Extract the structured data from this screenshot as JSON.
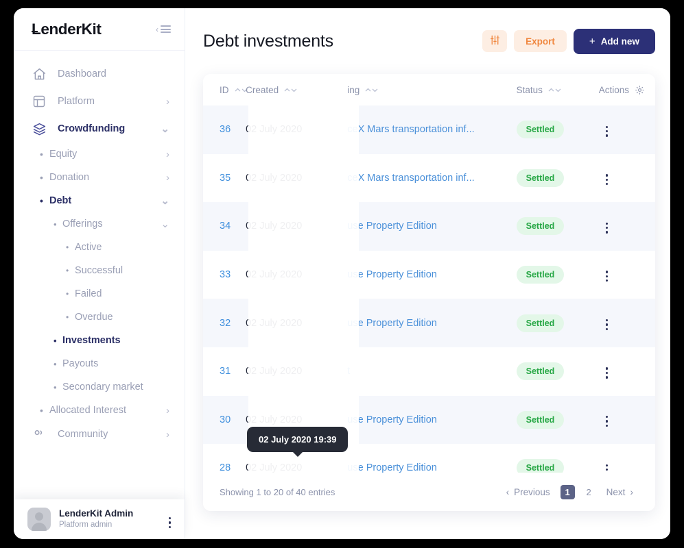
{
  "brand": {
    "name": "LenderKit",
    "collapse_icon": "collapse-menu-icon"
  },
  "sidebar": {
    "dashboard": {
      "label": "Dashboard",
      "icon": "home-icon"
    },
    "platform": {
      "label": "Platform",
      "icon": "layout-icon",
      "arrow": "›"
    },
    "crowdfunding": {
      "label": "Crowdfunding",
      "icon": "layers-icon",
      "arrow": "⌄"
    },
    "sub_items": [
      {
        "label": "Equity",
        "arrow": "›",
        "bullet": "•"
      },
      {
        "label": "Donation",
        "arrow": "›",
        "bullet": "•"
      },
      {
        "label": "Debt",
        "arrow": "⌄",
        "bullet": "•"
      }
    ],
    "offerings": {
      "label": "Offerings",
      "arrow": "⌄",
      "bullet": "•"
    },
    "offering_items": [
      {
        "label": "Active",
        "bullet": "•"
      },
      {
        "label": "Successful",
        "bullet": "•"
      },
      {
        "label": "Failed",
        "bullet": "•"
      },
      {
        "label": "Overdue",
        "bullet": "•"
      }
    ],
    "debt_items": [
      {
        "label": "Investments",
        "bullet": "•"
      },
      {
        "label": "Payouts",
        "bullet": "•"
      },
      {
        "label": "Secondary market",
        "bullet": "•"
      }
    ],
    "allocated_interest": {
      "label": "Allocated Interest",
      "arrow": "›",
      "bullet": "•"
    },
    "community": {
      "label": "Community",
      "arrow": "›",
      "icon": "community-icon"
    }
  },
  "user": {
    "name": "LenderKit Admin",
    "role": "Platform admin",
    "menu_icon": "three-dots-vertical-icon"
  },
  "header": {
    "title": "Debt investments",
    "filter_icon": "sliders-filter-icon",
    "export_label": "Export",
    "add_new_label": "Add new",
    "add_new_plus": "+"
  },
  "table": {
    "columns": [
      {
        "key": "id",
        "label": "ID",
        "sortable": true
      },
      {
        "key": "created",
        "label": "Created",
        "sortable": true
      },
      {
        "key": "offering",
        "label": "ing",
        "sortable": true
      },
      {
        "key": "status",
        "label": "Status",
        "sortable": true
      },
      {
        "key": "actions",
        "label": "Actions",
        "sortable": false,
        "gear_icon": "gear-icon"
      }
    ],
    "rows": [
      {
        "id": "36",
        "created": "02 July 2020",
        "offering": "ceX Mars transportation inf...",
        "status": "Settled"
      },
      {
        "id": "35",
        "created": "02 July 2020",
        "offering": "ceX Mars transportation inf...",
        "status": "Settled"
      },
      {
        "id": "34",
        "created": "02 July 2020",
        "offering": "use Property Edition",
        "status": "Settled"
      },
      {
        "id": "33",
        "created": "02 July 2020",
        "offering": "use Property Edition",
        "status": "Settled"
      },
      {
        "id": "32",
        "created": "02 July 2020",
        "offering": "use Property Edition",
        "status": "Settled"
      },
      {
        "id": "31",
        "created": "02 July 2020",
        "offering": "t",
        "status": "Settled"
      },
      {
        "id": "30",
        "created": "02 July 2020",
        "offering": "use Property Edition",
        "status": "Settled"
      },
      {
        "id": "28",
        "created": "02 July 2020",
        "offering": "use Property Edition",
        "status": "Settled"
      }
    ]
  },
  "tooltip": {
    "text": "02 July 2020 19:39"
  },
  "footer": {
    "entries": "Showing 1 to 20 of 40 entries",
    "previous": "Previous",
    "next": "Next",
    "pages": [
      "1",
      "2"
    ],
    "active_page": "1",
    "prev_chevron": "‹",
    "next_chevron": "›"
  },
  "colors": {
    "accent_navy": "#2c3077",
    "accent_orange": "#f0873f",
    "status_green": "#27a745",
    "link_blue": "#4a90d9",
    "tooltip_bg": "#272b36"
  }
}
